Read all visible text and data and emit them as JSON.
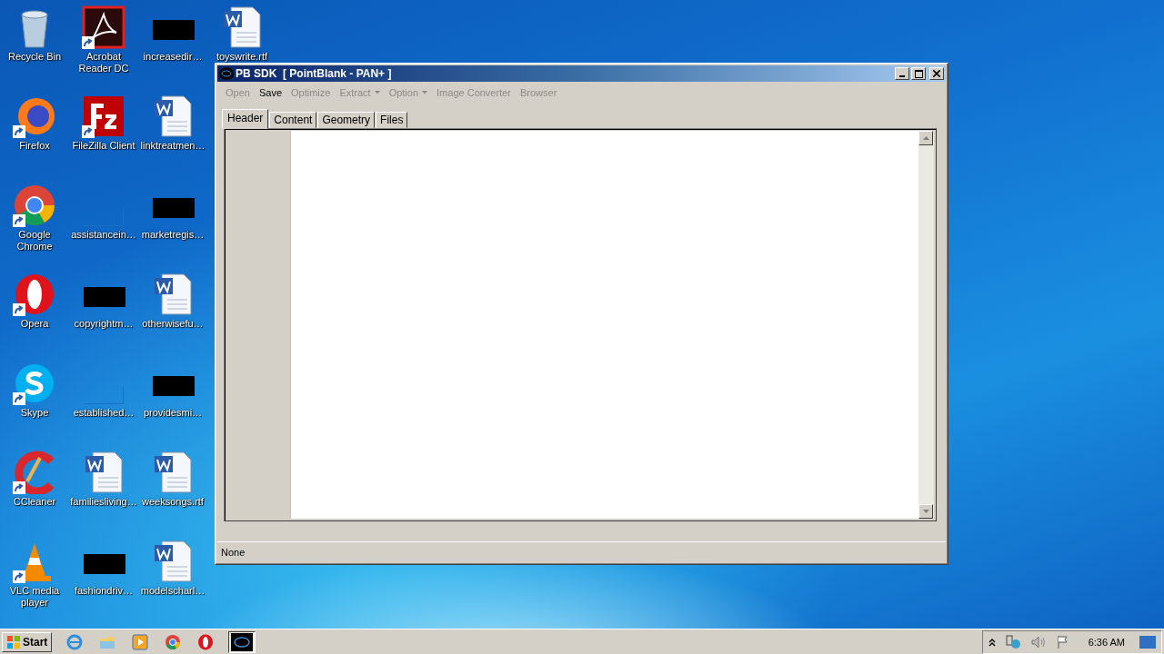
{
  "desktop_columns": [
    [
      {
        "label": "Recycle Bin",
        "kind": "recycle",
        "shortcut": false
      },
      {
        "label": "Firefox",
        "kind": "firefox",
        "shortcut": true
      },
      {
        "label": "Google Chrome",
        "kind": "chrome",
        "shortcut": true
      },
      {
        "label": "Opera",
        "kind": "opera",
        "shortcut": true
      },
      {
        "label": "Skype",
        "kind": "skype",
        "shortcut": true
      },
      {
        "label": "CCleaner",
        "kind": "ccleaner",
        "shortcut": true
      },
      {
        "label": "VLC media player",
        "kind": "vlc",
        "shortcut": true
      }
    ],
    [
      {
        "label": "Acrobat Reader DC",
        "kind": "acrobat",
        "shortcut": true
      },
      {
        "label": "FileZilla Client",
        "kind": "filezilla",
        "shortcut": true
      },
      {
        "label": "assistancein…",
        "kind": "blank",
        "shortcut": false
      },
      {
        "label": "copyrightm…",
        "kind": "black",
        "shortcut": false
      },
      {
        "label": "established…",
        "kind": "blank",
        "shortcut": false
      },
      {
        "label": "familiesliving…",
        "kind": "word",
        "shortcut": false
      },
      {
        "label": "fashiondriv…",
        "kind": "black",
        "shortcut": false
      }
    ],
    [
      {
        "label": "increasedir…",
        "kind": "black",
        "shortcut": false
      },
      {
        "label": "linktreatmen…",
        "kind": "word",
        "shortcut": false
      },
      {
        "label": "marketregis…",
        "kind": "black",
        "shortcut": false
      },
      {
        "label": "otherwisefu…",
        "kind": "word",
        "shortcut": false
      },
      {
        "label": "providesmi…",
        "kind": "black",
        "shortcut": false
      },
      {
        "label": "weeksongs.rtf",
        "kind": "word",
        "shortcut": false
      },
      {
        "label": "modelscharl…",
        "kind": "word",
        "shortcut": false
      }
    ],
    [
      {
        "label": "toyswrite.rtf",
        "kind": "word",
        "shortcut": false
      }
    ]
  ],
  "window": {
    "title": "PB SDK  [ PointBlank - PAN+ ]",
    "menu": [
      {
        "label": "Open",
        "disabled": true,
        "dropdown": false
      },
      {
        "label": "Save",
        "disabled": false,
        "dropdown": false
      },
      {
        "label": "Optimize",
        "disabled": true,
        "dropdown": false
      },
      {
        "label": "Extract",
        "disabled": true,
        "dropdown": true
      },
      {
        "label": "Option",
        "disabled": true,
        "dropdown": true
      },
      {
        "label": "Image Converter",
        "disabled": true,
        "dropdown": false
      },
      {
        "label": "Browser",
        "disabled": true,
        "dropdown": false
      }
    ],
    "tabs": [
      {
        "label": "Header",
        "selected": true
      },
      {
        "label": "Content",
        "selected": false
      },
      {
        "label": "Geometry",
        "selected": false
      },
      {
        "label": "Files",
        "selected": false
      }
    ],
    "status": "None"
  },
  "taskbar": {
    "start": "Start",
    "items": [
      {
        "kind": "ie",
        "active": false
      },
      {
        "kind": "explorer",
        "active": false
      },
      {
        "kind": "media",
        "active": false
      },
      {
        "kind": "chrome",
        "active": false
      },
      {
        "kind": "opera",
        "active": false
      },
      {
        "kind": "app",
        "active": true
      }
    ],
    "clock": "6:36 AM"
  }
}
